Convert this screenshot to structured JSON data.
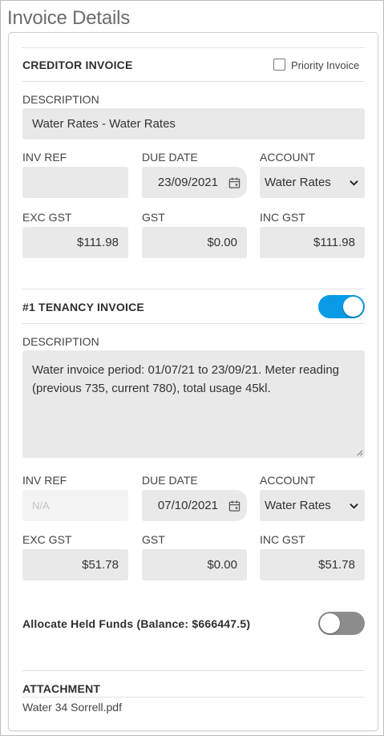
{
  "page": {
    "title": "Invoice Details"
  },
  "creditor": {
    "section_title": "CREDITOR INVOICE",
    "priority_label": "Priority Invoice",
    "priority_checked": false,
    "description_label": "DESCRIPTION",
    "description_value": "Water Rates - Water Rates",
    "inv_ref_label": "INV REF",
    "inv_ref_value": "",
    "due_date_label": "DUE DATE",
    "due_date_value": "23/09/2021",
    "account_label": "ACCOUNT",
    "account_value": "Water Rates",
    "exc_gst_label": "EXC GST",
    "exc_gst_value": "$111.98",
    "gst_label": "GST",
    "gst_value": "$0.00",
    "inc_gst_label": "INC GST",
    "inc_gst_value": "$111.98"
  },
  "tenancy": {
    "section_title": "#1 TENANCY INVOICE",
    "enabled": true,
    "description_label": "DESCRIPTION",
    "description_value": "Water invoice period: 01/07/21 to 23/09/21. Meter reading (previous 735, current 780), total usage 45kl.",
    "inv_ref_label": "INV REF",
    "inv_ref_placeholder": "N/A",
    "due_date_label": "DUE DATE",
    "due_date_value": "07/10/2021",
    "account_label": "ACCOUNT",
    "account_value": "Water Rates",
    "exc_gst_label": "EXC GST",
    "exc_gst_value": "$51.78",
    "gst_label": "GST",
    "gst_value": "$0.00",
    "inc_gst_label": "INC GST",
    "inc_gst_value": "$51.78"
  },
  "held_funds": {
    "label": "Allocate Held Funds (Balance: $666447.5)",
    "enabled": false
  },
  "attachment": {
    "section_title": "ATTACHMENT",
    "file_name": "Water 34 Sorrell.pdf"
  },
  "icons": {
    "calendar": "calendar-icon",
    "chevron": "chevron-down-icon",
    "resize": "resize-handle-icon"
  },
  "colors": {
    "toggle_on": "#0a9be6",
    "toggle_off": "#8c8c8c",
    "field_bg": "#e9e9e9"
  }
}
